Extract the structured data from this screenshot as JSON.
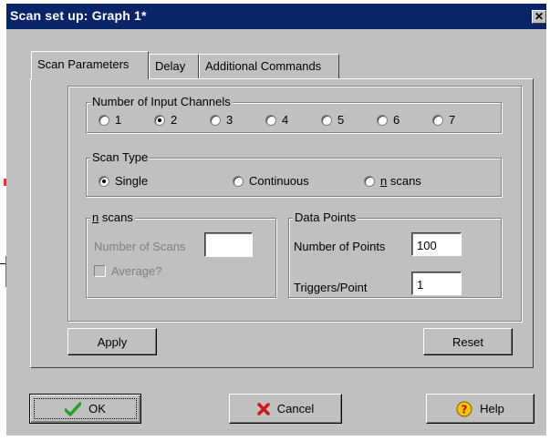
{
  "window": {
    "title": "Scan set up: Graph 1*",
    "close_glyph": "✕"
  },
  "tabs": [
    {
      "label": "Scan Parameters",
      "active": true
    },
    {
      "label": "Delay",
      "active": false
    },
    {
      "label": "Additional Commands",
      "active": false
    }
  ],
  "input_channels": {
    "legend": "Number of Input Channels",
    "options": [
      "1",
      "2",
      "3",
      "4",
      "5",
      "6",
      "7"
    ],
    "selected": "2"
  },
  "scan_type": {
    "legend": "Scan Type",
    "options": [
      {
        "label": "Single",
        "underline": ""
      },
      {
        "label": "Continuous",
        "underline": ""
      },
      {
        "label": "n scans",
        "underline": "n"
      }
    ],
    "selected": "Single"
  },
  "n_scans": {
    "legend": "n scans",
    "legend_underline": "n",
    "number_of_scans_label": "Number of Scans",
    "number_of_scans_value": "",
    "average_label": "Average?",
    "average_checked": false,
    "disabled": true
  },
  "data_points": {
    "legend": "Data Points",
    "number_of_points_label": "Number of Points",
    "number_of_points_value": "100",
    "triggers_label": "Triggers/Point",
    "triggers_value": "1"
  },
  "buttons": {
    "apply": "Apply",
    "reset": "Reset",
    "ok": "OK",
    "cancel": "Cancel",
    "help": "Help"
  },
  "icons": {
    "ok": "check-icon",
    "cancel": "x-icon",
    "help": "question-icon"
  },
  "colors": {
    "titlebar": "#0a246a",
    "face": "#c0c0c0",
    "ok_check": "#2e9b2e",
    "cancel_x": "#d01818",
    "help_bg": "#f4c400",
    "stray_mark": "#d04040"
  }
}
